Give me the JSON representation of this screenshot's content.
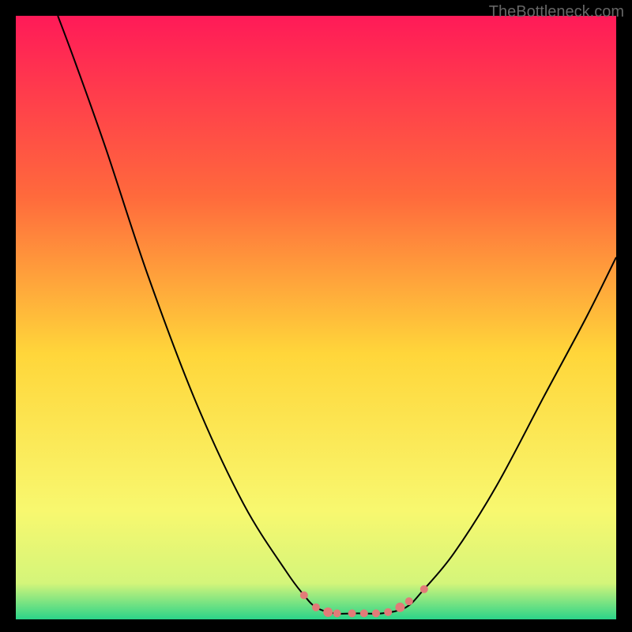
{
  "watermark": "TheBottleneck.com",
  "chart_data": {
    "type": "line",
    "title": "",
    "xlabel": "",
    "ylabel": "",
    "xlim": [
      0,
      100
    ],
    "ylim": [
      0,
      100
    ],
    "background_gradient": {
      "top": "#ff1a58",
      "mid_top": "#ff6a3c",
      "mid": "#ffd63a",
      "mid_bottom": "#f8f86f",
      "bottom": "#2bd489"
    },
    "curve": {
      "name": "bottleneck-curve",
      "color": "#000000",
      "points": [
        {
          "x": 7,
          "y": 100
        },
        {
          "x": 10,
          "y": 92
        },
        {
          "x": 15,
          "y": 78
        },
        {
          "x": 22,
          "y": 57
        },
        {
          "x": 30,
          "y": 36
        },
        {
          "x": 38,
          "y": 19
        },
        {
          "x": 45,
          "y": 8
        },
        {
          "x": 48,
          "y": 4
        },
        {
          "x": 50,
          "y": 2
        },
        {
          "x": 53,
          "y": 1
        },
        {
          "x": 57,
          "y": 1
        },
        {
          "x": 61,
          "y": 1
        },
        {
          "x": 65,
          "y": 2
        },
        {
          "x": 68,
          "y": 5
        },
        {
          "x": 73,
          "y": 11
        },
        {
          "x": 80,
          "y": 22
        },
        {
          "x": 88,
          "y": 37
        },
        {
          "x": 95,
          "y": 50
        },
        {
          "x": 100,
          "y": 60
        }
      ]
    },
    "markers": {
      "color": "#e27b78",
      "stroke": "#d66",
      "points": [
        {
          "x": 48,
          "y": 4,
          "r": 5
        },
        {
          "x": 50,
          "y": 2,
          "r": 5
        },
        {
          "x": 52,
          "y": 1.2,
          "r": 6
        },
        {
          "x": 53.5,
          "y": 1,
          "r": 5
        },
        {
          "x": 56,
          "y": 1,
          "r": 5
        },
        {
          "x": 58,
          "y": 1,
          "r": 5
        },
        {
          "x": 60,
          "y": 1,
          "r": 5
        },
        {
          "x": 62,
          "y": 1.2,
          "r": 5
        },
        {
          "x": 64,
          "y": 2,
          "r": 6
        },
        {
          "x": 65.5,
          "y": 3,
          "r": 5
        },
        {
          "x": 68,
          "y": 5,
          "r": 5
        }
      ]
    }
  }
}
